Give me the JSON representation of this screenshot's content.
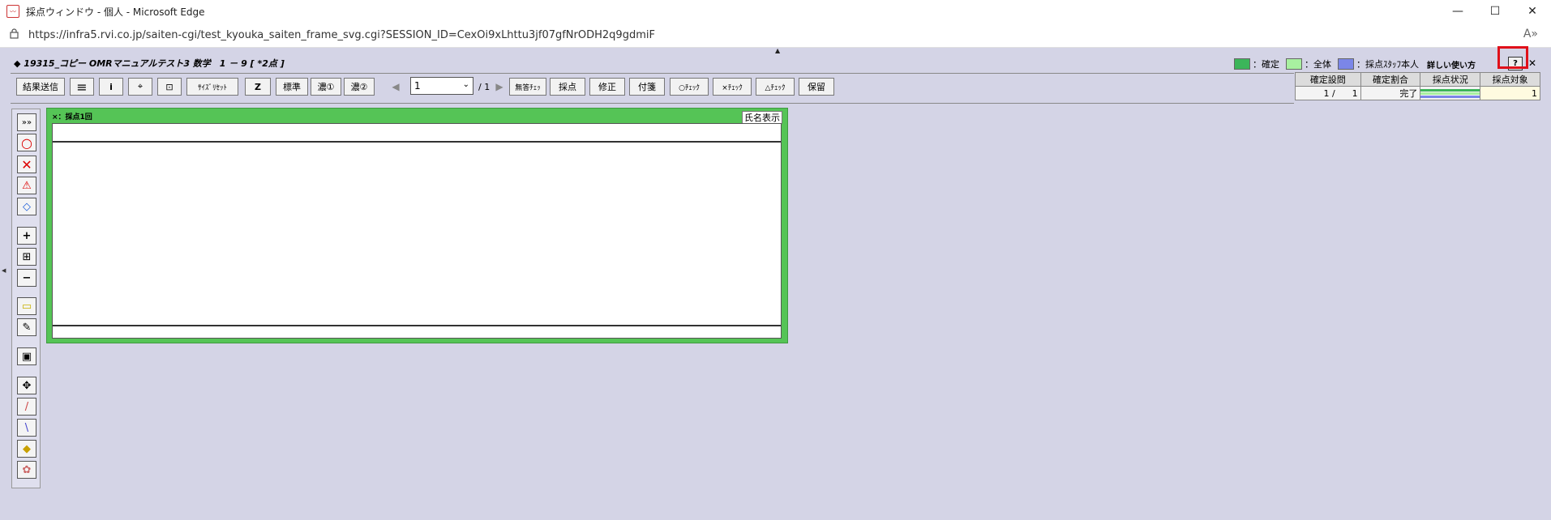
{
  "window": {
    "title": "採点ウィンドウ - 個人 - Microsoft Edge",
    "minimize": "—",
    "maximize": "☐",
    "close": "✕"
  },
  "address": {
    "url": "https://infra5.rvi.co.jp/saiten-cgi/test_kyouka_saiten_frame_svg.cgi?SESSION_ID=CexOi9xLhttu3jf07gfNrODH2q9gdmiF",
    "read_aloud": "A»"
  },
  "header": {
    "title": "◆ 19315_コピー OMRマニュアルテスト3 数学　1 － 9 [ *2点 ]",
    "legend": [
      {
        "label": "：確定",
        "color": "#3cb55a"
      },
      {
        "label": "：全体",
        "color": "#a8f0a0"
      },
      {
        "label": "：採点ｽﾀｯﾌ本人",
        "color": "#7b86e8"
      }
    ],
    "detail_link": "詳しい使い方",
    "help": "?",
    "close": "✕"
  },
  "toolbar": {
    "send": "結果送信",
    "list_icon": "≡",
    "info_icon": "i",
    "fit": "⌖",
    "zoom": "⊡",
    "size_reset": "ｻｲｽﾞﾘｾｯﾄ",
    "z_icon": "Z",
    "standard": "標準",
    "dark1": "濃①",
    "dark2": "濃②",
    "prev": "◀",
    "page": "1",
    "page_total": "/ 1",
    "next": "▶",
    "no_answer": "無答ﾁｪｯ",
    "grade": "採点",
    "fix": "修正",
    "sticky": "付箋",
    "o_check": "○ﾁｪｯｸ",
    "x_check": "×ﾁｪｯｸ",
    "tri_check": "△ﾁｪｯｸ",
    "hold": "保留"
  },
  "status": {
    "headers": [
      "確定設問",
      "確定割合",
      "採点状況",
      "採点対象"
    ],
    "confirmed_left": "1 /",
    "confirmed_right": "1",
    "ratio": "完了",
    "target": "1",
    "bar_colors": [
      "#3cb55a",
      "#a8f0a0",
      "#7b86e8"
    ]
  },
  "tools": [
    "»»",
    "○",
    "✕",
    "⚠",
    "◇",
    "+",
    "⊞",
    "−",
    "▭",
    "✎",
    "▣",
    "✥",
    "/",
    "\\",
    "◆",
    "✿"
  ],
  "panel": {
    "label": "×：採点1回",
    "name_btn": "氏名表示"
  },
  "markers": {
    "top": "▲",
    "side": "◀"
  }
}
